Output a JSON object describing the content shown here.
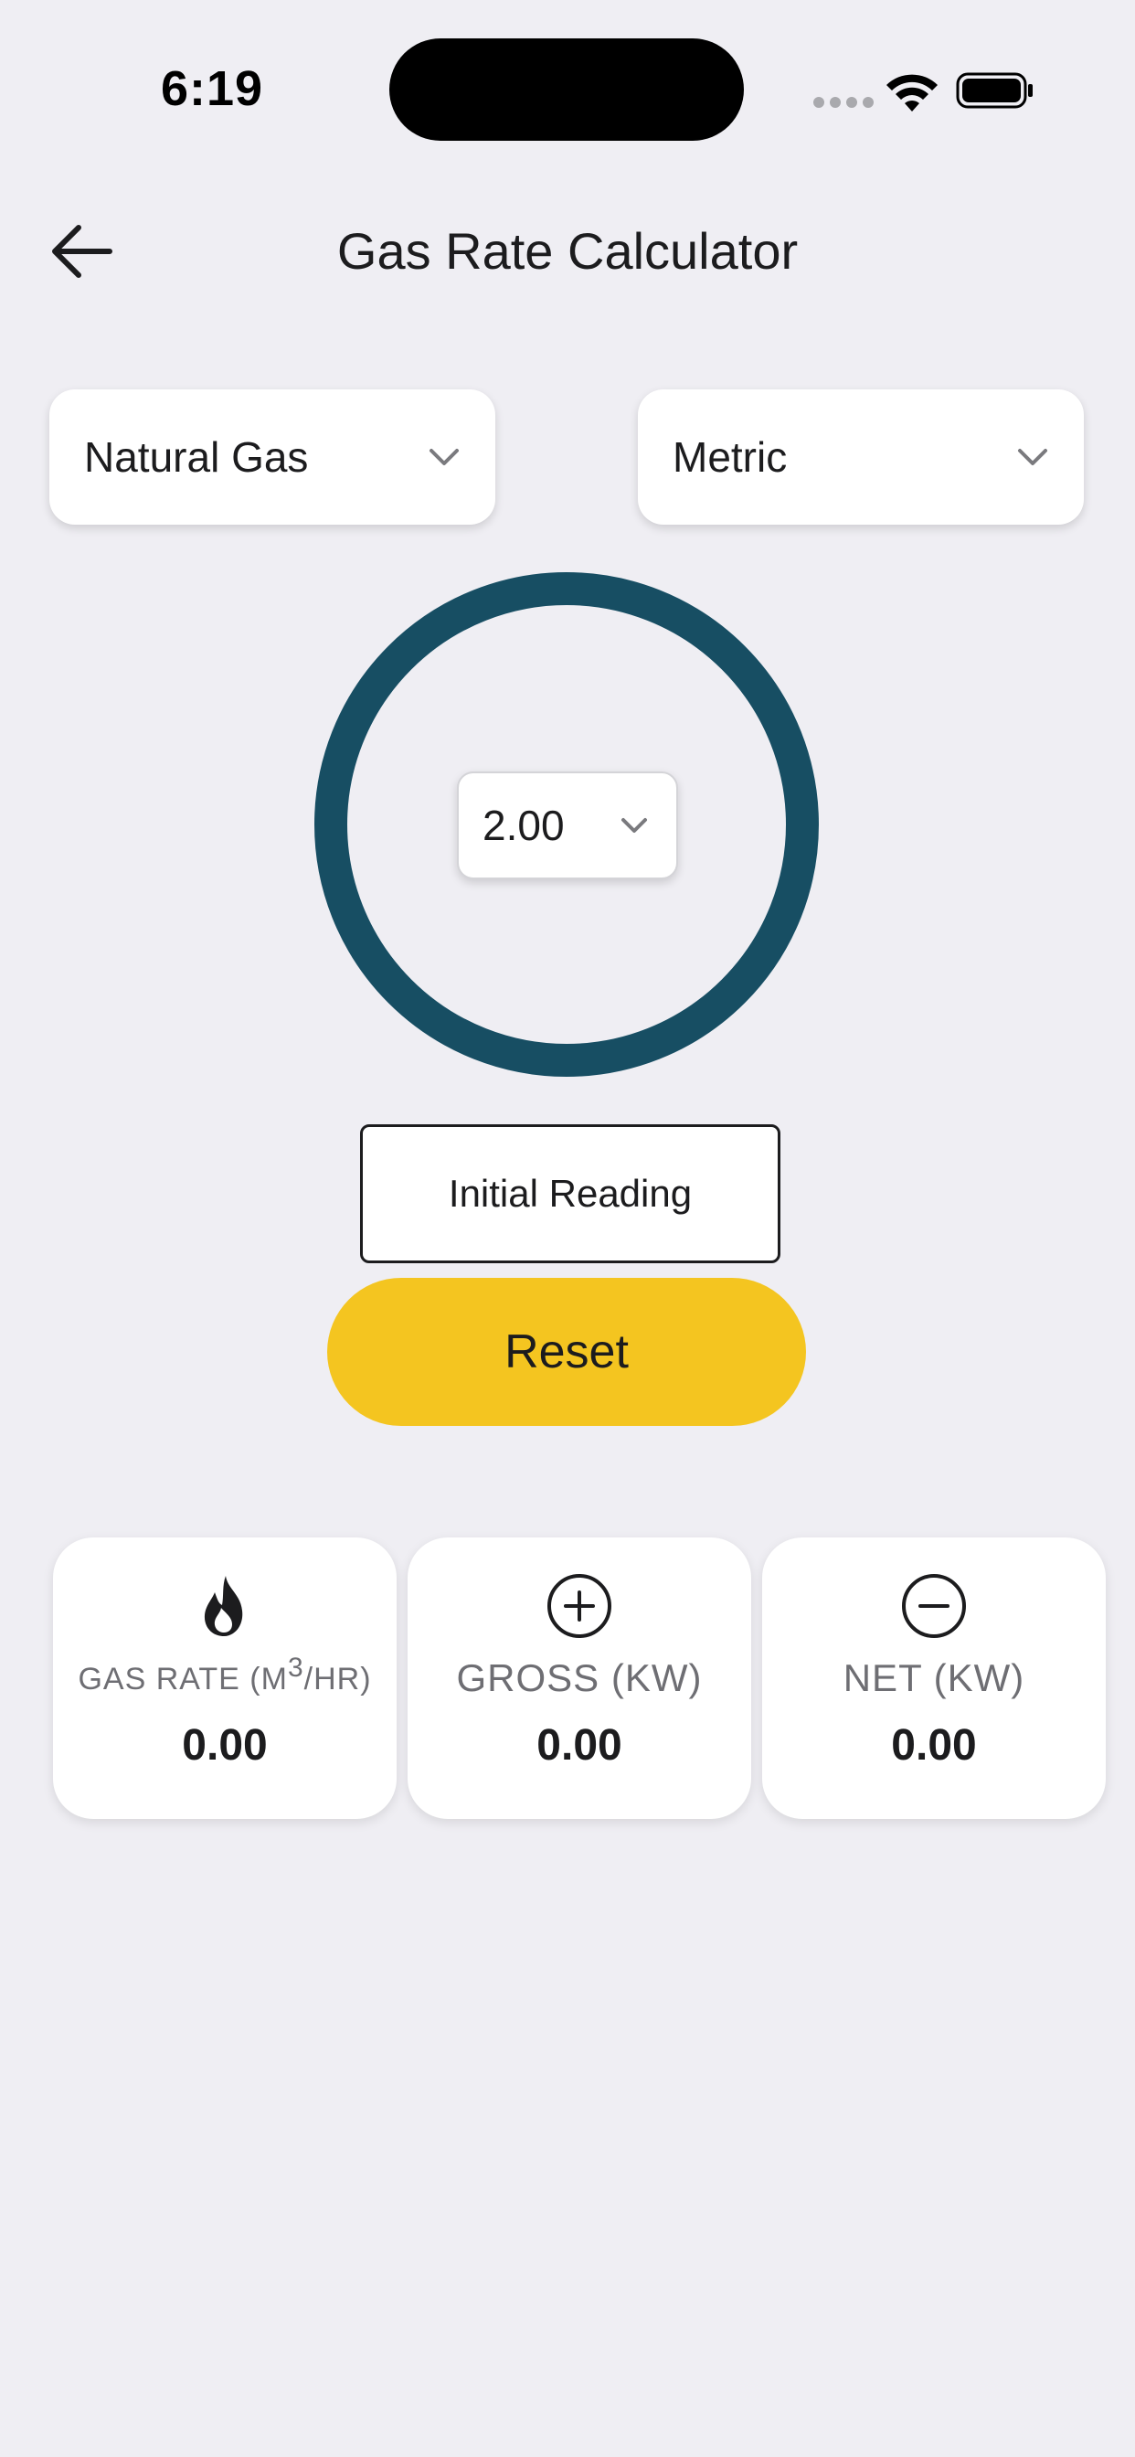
{
  "status_bar": {
    "time": "6:19"
  },
  "header": {
    "title": "Gas Rate Calculator",
    "back_icon": "arrow-left-icon"
  },
  "selectors": {
    "gas_type": "Natural Gas",
    "unit_system": "Metric",
    "dial_value": "2.00"
  },
  "dial": {
    "ring_color": "#174e63"
  },
  "buttons": {
    "initial_reading": "Initial Reading",
    "reset": "Reset",
    "reset_color": "#f4c520"
  },
  "cards": {
    "gas_rate": {
      "label_prefix": "GAS RATE (M",
      "label_sup": "3",
      "label_suffix": "/HR)",
      "value": "0.00",
      "icon": "flame-icon"
    },
    "gross": {
      "label": "GROSS (KW)",
      "value": "0.00",
      "icon": "plus-circle-icon"
    },
    "net": {
      "label": "NET (KW)",
      "value": "0.00",
      "icon": "minus-circle-icon"
    }
  }
}
